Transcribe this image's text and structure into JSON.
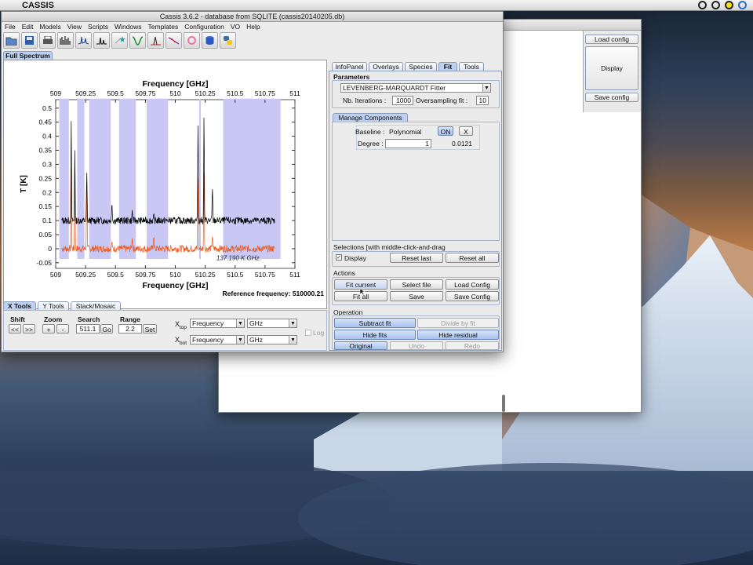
{
  "menubar": {
    "app_name": "CASSIS"
  },
  "window": {
    "title": "Cassis 3.6.2 - database from SQLITE (cassis20140205.db)"
  },
  "menu": [
    "File",
    "Edit",
    "Models",
    "View",
    "Scripts",
    "Windows",
    "Templates",
    "Configuration",
    "VO",
    "Help"
  ],
  "bg_window": {
    "load_config": "Load config",
    "display": "Display",
    "save_config": "Save config"
  },
  "main_tab": "Full Spectrum",
  "plot": {
    "top_axis_label": "Frequency [GHz]",
    "bottom_axis_label": "Frequency [GHz]",
    "y_axis_label": "T [K]",
    "x_ticks": [
      "509",
      "509.25",
      "509.5",
      "509.75",
      "510",
      "510.25",
      "510.5",
      "510.75",
      "511"
    ],
    "y_ticks": [
      "0.5",
      "0.45",
      "0.4",
      "0.35",
      "0.3",
      "0.25",
      "0.2",
      "0.15",
      "0.1",
      "0.05",
      "0",
      "-0.05"
    ],
    "annotation": "137.190 K.GHz.",
    "reference": "Reference frequency: 510000.21"
  },
  "chart_data": {
    "type": "line",
    "xlabel": "Frequency [GHz]",
    "ylabel": "T [K]",
    "xlim": [
      509,
      511
    ],
    "ylim": [
      -0.07,
      0.53
    ],
    "series": [
      {
        "name": "",
        "color": "#000000",
        "x": [
          509,
          509.1,
          509.15,
          509.25,
          509.5,
          509.75,
          510,
          510.12,
          510.2,
          510.25,
          510.3,
          510.5,
          510.75,
          511
        ],
        "values": [
          0.1,
          0.1,
          0.1,
          0.1,
          0.1,
          0.1,
          0.1,
          0.1,
          0.1,
          0.1,
          0.1,
          0.1,
          0.1,
          0.1
        ]
      },
      {
        "name": "",
        "color": "#e8561a",
        "x": [
          509,
          509.1,
          509.15,
          509.25,
          509.5,
          509.75,
          510,
          510.12,
          510.2,
          510.25,
          510.3,
          510.5,
          510.75,
          511
        ],
        "values": [
          0,
          0,
          0,
          0,
          0,
          0,
          0,
          0,
          0,
          0,
          0,
          0,
          0,
          0
        ]
      }
    ],
    "peaks": [
      {
        "x": 509.13,
        "black": 0.46,
        "orange": 0.29
      },
      {
        "x": 509.16,
        "black": 0.36,
        "orange": 0.26
      },
      {
        "x": 509.26,
        "black": 0.29,
        "orange": 0.25
      },
      {
        "x": 509.47,
        "black": 0.17,
        "orange": 0.03
      },
      {
        "x": 509.64,
        "black": 0.14,
        "orange": 0.04
      },
      {
        "x": 509.82,
        "black": 0.13,
        "orange": 0.05
      },
      {
        "x": 510.19,
        "black": 0.49,
        "orange": 0.29
      },
      {
        "x": 510.24,
        "black": 0.49,
        "orange": 0.29
      },
      {
        "x": 510.31,
        "black": 0.23,
        "orange": 0.05
      }
    ],
    "shaded_regions": [
      [
        509.03,
        509.11
      ],
      [
        509.18,
        509.24
      ],
      [
        509.28,
        509.46
      ],
      [
        509.53,
        509.67
      ],
      [
        509.76,
        509.94
      ],
      [
        510.2,
        510.2
      ],
      [
        510.4,
        510.88
      ]
    ]
  },
  "bottom_tabs": [
    "X Tools",
    "Y Tools",
    "Stack/Mosaic"
  ],
  "xtools": {
    "shift_label": "Shift",
    "shift_left": "<<",
    "shift_right": ">>",
    "zoom_label": "Zoom",
    "zoom_in": "+",
    "zoom_out": "-",
    "search_label": "Search",
    "search_value": "511.1",
    "search_go": "Go",
    "range_label": "Range",
    "range_value": "2.2",
    "range_set": "Set",
    "xtop_label": "X",
    "xtop_sub": "top",
    "xbot_label": "X",
    "xbot_sub": "bot",
    "xtop_type": "Frequency",
    "xtop_unit": "GHz",
    "xbot_type": "Frequency",
    "xbot_unit": "GHz",
    "log_label": "Log"
  },
  "right_tabs": [
    "InfoPanel",
    "Overlays",
    "Species",
    "Fit",
    "Tools"
  ],
  "fit": {
    "parameters_label": "Parameters",
    "fitter": "LEVENBERG-MARQUARDT Fitter",
    "iterations_label": "Nb. Iterations :",
    "iterations_value": "1000",
    "oversampling_label": "Oversampling fit :",
    "oversampling_value": "10",
    "manage_components": "Manage Components",
    "baseline_label": "Baseline :",
    "baseline_type": "Polynomial",
    "baseline_on": "ON",
    "baseline_x": "X",
    "degree_label": "Degree :",
    "degree_value": "1",
    "degree_result": "0.0121",
    "selections_label": "Selections [with middle-click-and-drag",
    "display_label": "Display",
    "reset_last": "Reset last",
    "reset_all": "Reset all",
    "actions_label": "Actions",
    "fit_current": "Fit current",
    "select_file": "Select file",
    "load_config": "Load Config",
    "fit_all": "Fit all",
    "save": "Save",
    "save_config": "Save Config",
    "operation_label": "Operation",
    "subtract_fit": "Subtract fit",
    "divide_by_fit": "Divide by fit",
    "hide_fits": "Hide fits",
    "hide_residual": "Hide residual",
    "original": "Original",
    "undo": "Undo",
    "redo": "Redo"
  }
}
